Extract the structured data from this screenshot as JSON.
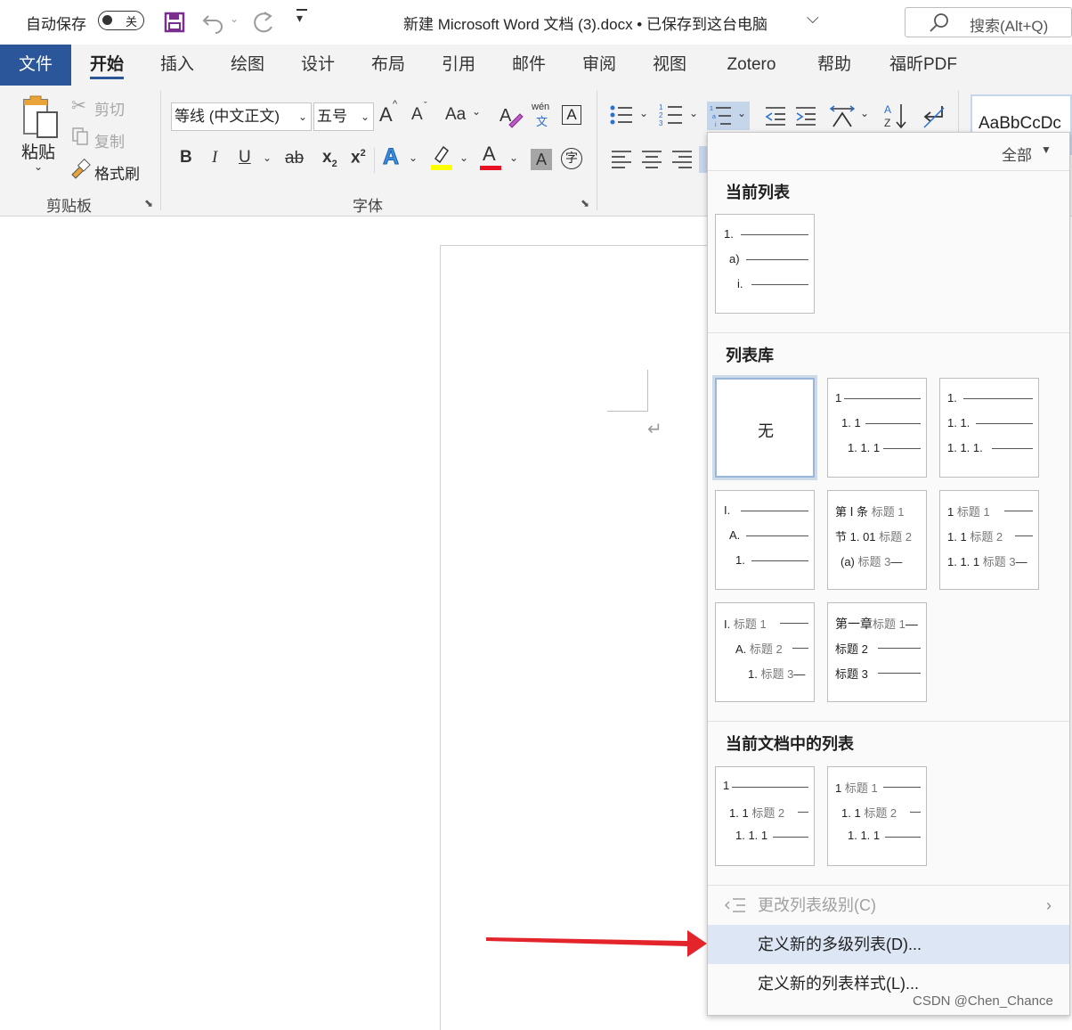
{
  "titlebar": {
    "autosave_label": "自动保存",
    "autosave_state": "关",
    "doc_title": "新建 Microsoft Word 文档 (3).docx • 已保存到这台电脑",
    "search_placeholder": "搜索(Alt+Q)"
  },
  "tabs": [
    "文件",
    "开始",
    "插入",
    "绘图",
    "设计",
    "布局",
    "引用",
    "邮件",
    "审阅",
    "视图",
    "Zotero",
    "帮助",
    "福昕PDF"
  ],
  "active_tab": "开始",
  "ribbon": {
    "clipboard": {
      "paste": "粘贴",
      "cut": "剪切",
      "copy": "复制",
      "format_painter": "格式刷",
      "group_label": "剪贴板"
    },
    "font": {
      "font_name": "等线 (中文正文)",
      "font_size": "五号",
      "grow": "A",
      "shrink": "A",
      "change_case": "Aa",
      "phonetic_top": "wén",
      "phonetic_bottom": "文",
      "bold": "B",
      "italic": "I",
      "underline": "U",
      "strike": "ab",
      "subscript": "x",
      "superscript": "x",
      "subscript_mark": "2",
      "superscript_mark": "2",
      "text_effect": "A",
      "font_color": "A",
      "char_shading": "A",
      "enclose_char": "字",
      "group_label": "字体"
    },
    "styles_preview": "AaBbCcDc"
  },
  "colors": {
    "accent": "#2b579a",
    "highlight_yellow": "#ffff00",
    "font_red": "#e81123",
    "arrow_red": "#e3242b",
    "menu_highlight": "#dce6f4"
  },
  "menu": {
    "filter_label": "全部",
    "sections": {
      "current": "当前列表",
      "library": "列表库",
      "in_document": "当前文档中的列表"
    },
    "current_thumb": [
      "1.",
      "a)",
      "i."
    ],
    "library": {
      "none_label": "无",
      "t2": [
        "1",
        "1. 1",
        "1. 1. 1"
      ],
      "t3": [
        "1.",
        "1. 1.",
        "1. 1. 1."
      ],
      "t4": [
        "I.",
        "A.",
        "1."
      ],
      "t5": {
        "l1_prefix": "第 Ⅰ 条",
        "l2_prefix": "节 1. 01",
        "l3_prefix": "(a)",
        "l1_suffix": "标题 1",
        "l2_suffix": "标题 2",
        "l3_suffix": "标题 3"
      },
      "t6": {
        "l1": "1",
        "l2": "1. 1",
        "l3": "1. 1. 1",
        "s1": "标题 1",
        "s2": "标题 2",
        "s3": "标题 3"
      },
      "t7": {
        "l1": "I.",
        "l2": "A.",
        "l3": "1.",
        "s1": "标题 1",
        "s2": "标题 2",
        "s3": "标题 3"
      },
      "t8": {
        "l1_prefix": "第一章",
        "s1": "标题 1",
        "s2": "标题 2",
        "s3": "标题 3"
      }
    },
    "document_lists": {
      "d1": {
        "l1": "1",
        "l2": "1. 1",
        "l3": "1. 1. 1",
        "s2": "标题 2"
      },
      "d2": {
        "l1": "1",
        "l2": "1. 1",
        "l3": "1. 1. 1",
        "s1": "标题 1",
        "s2": "标题 2"
      }
    },
    "items": {
      "change_level": "更改列表级别(C)",
      "define_new_multilevel": "定义新的多级列表(D)...",
      "define_new_style": "定义新的列表样式(L)..."
    }
  },
  "watermark": "CSDN @Chen_Chance"
}
